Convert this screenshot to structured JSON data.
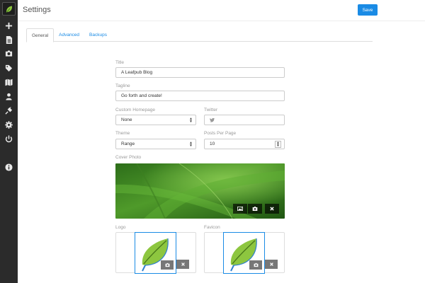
{
  "app": {
    "title": "Settings",
    "save_label": "Save",
    "accent": "#1a8be5"
  },
  "sidebar": {
    "items": [
      {
        "icon": "leaf-logo-icon"
      },
      {
        "icon": "plus-icon"
      },
      {
        "icon": "file-icon"
      },
      {
        "icon": "camera-icon"
      },
      {
        "icon": "tags-icon"
      },
      {
        "icon": "map-icon"
      },
      {
        "icon": "user-icon"
      },
      {
        "icon": "plug-icon"
      },
      {
        "icon": "gear-icon"
      },
      {
        "icon": "power-icon"
      },
      {
        "icon": "info-icon"
      }
    ]
  },
  "tabs": [
    {
      "label": "General",
      "active": true
    },
    {
      "label": "Advanced",
      "active": false
    },
    {
      "label": "Backups",
      "active": false
    }
  ],
  "form": {
    "title_label": "Title",
    "title_value": "A Leafpub Blog",
    "tagline_label": "Tagline",
    "tagline_value": "Go forth and create!",
    "homepage_label": "Custom Homepage",
    "homepage_value": "None",
    "twitter_label": "Twitter",
    "twitter_placeholder": "",
    "theme_label": "Theme",
    "theme_value": "Range",
    "posts_label": "Posts Per Page",
    "posts_value": "10",
    "cover_label": "Cover Photo",
    "logo_label": "Logo",
    "favicon_label": "Favicon"
  }
}
